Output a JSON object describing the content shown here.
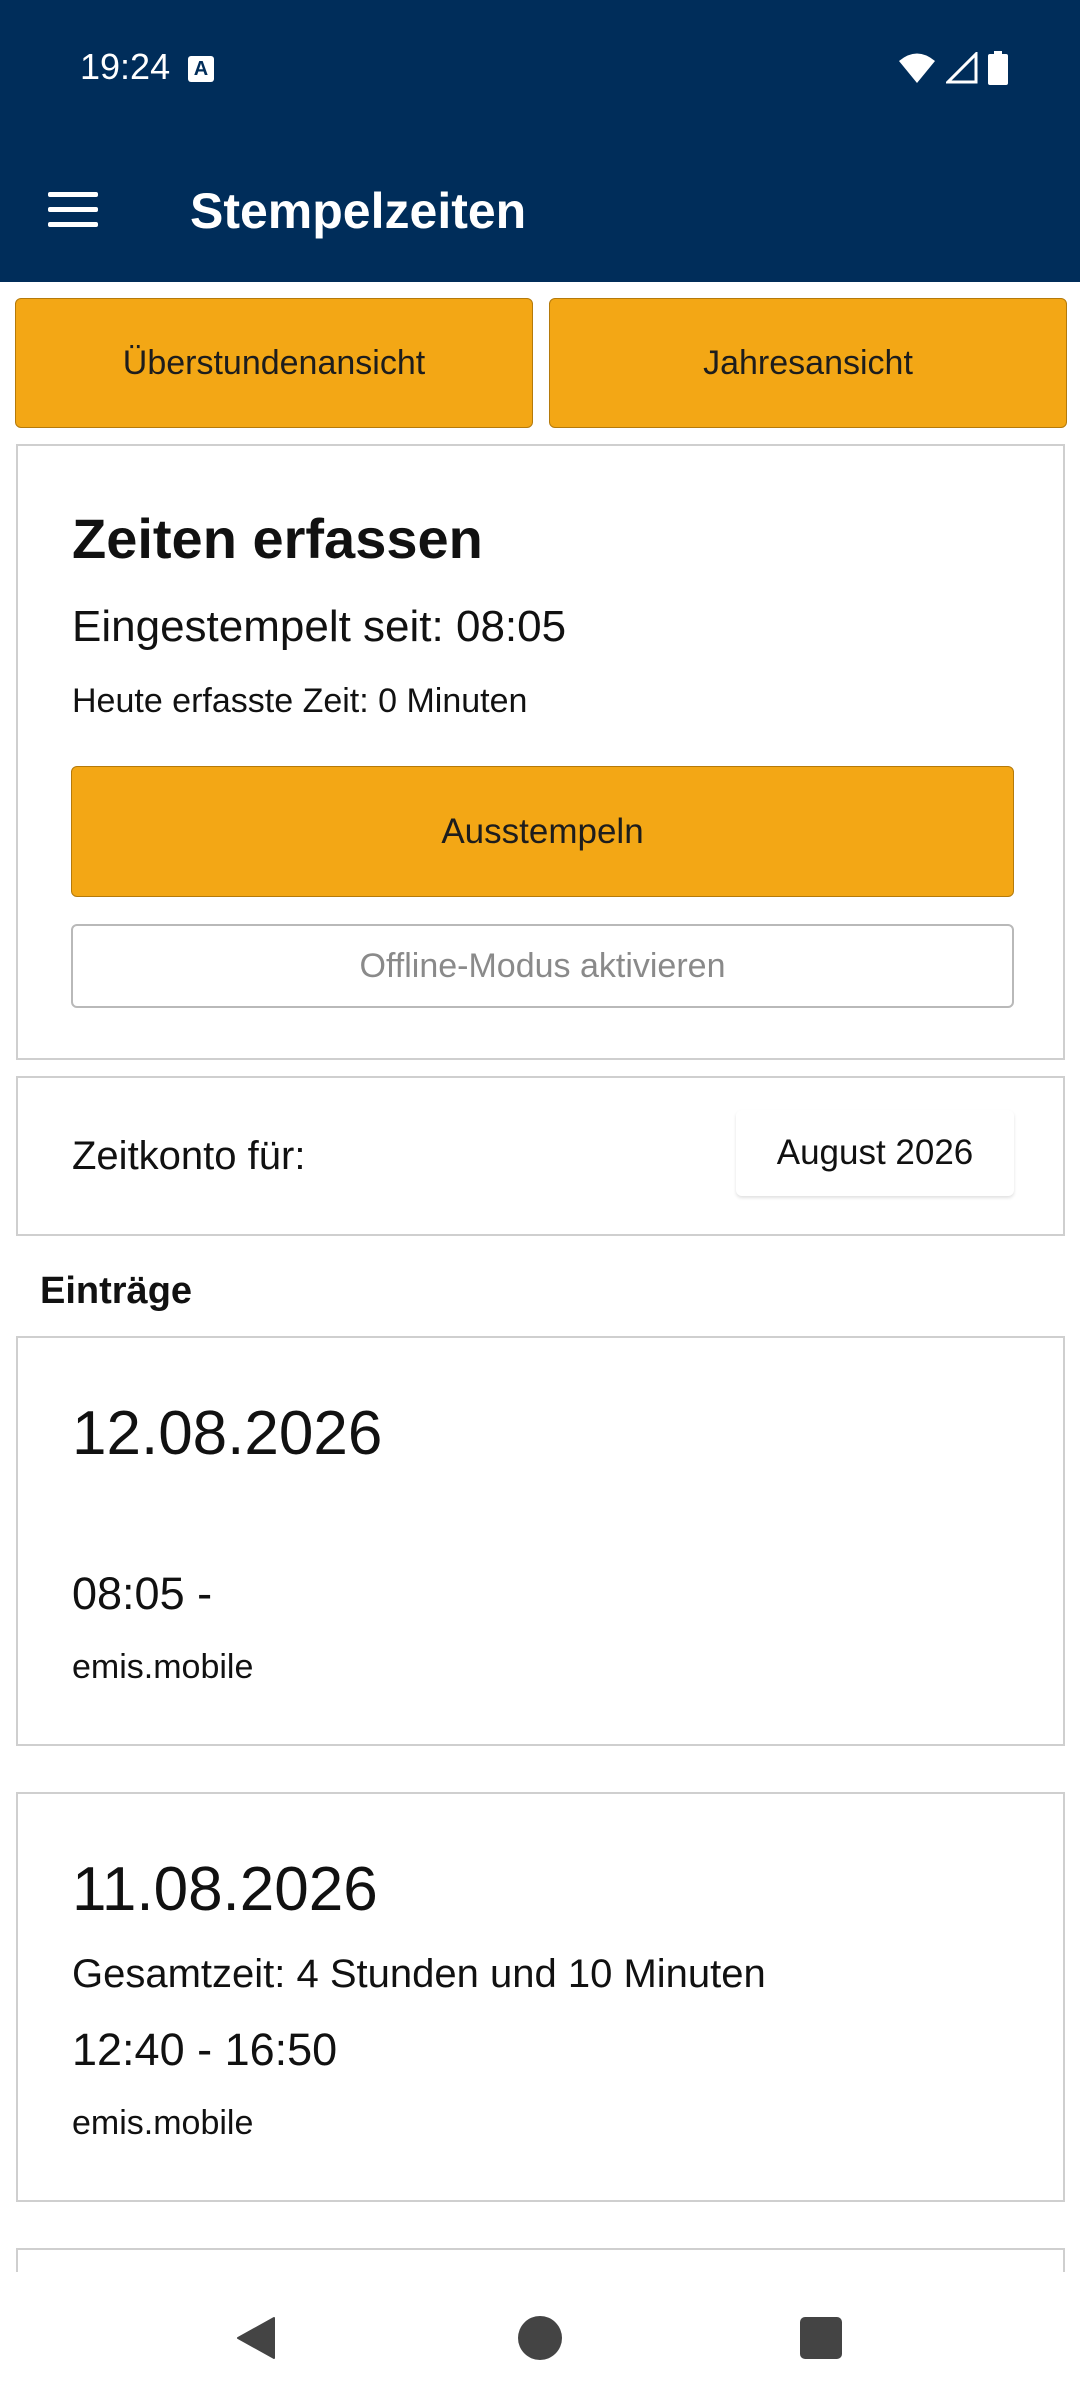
{
  "status_bar": {
    "time": "19:24",
    "indicator_letter": "A",
    "icons": [
      "wifi-icon",
      "signal-icon",
      "battery-icon"
    ]
  },
  "app_bar": {
    "title": "Stempelzeiten",
    "menu_icon": "hamburger-menu-icon"
  },
  "view_buttons": {
    "overtime_label": "Überstundenansicht",
    "year_label": "Jahresansicht"
  },
  "time_entry": {
    "title": "Zeiten erfassen",
    "clocked_in_since": "Eingestempelt seit: 08:05",
    "today_time": "Heute erfasste Zeit: 0 Minuten",
    "clock_out_label": "Ausstempeln",
    "offline_label": "Offline-Modus aktivieren"
  },
  "account": {
    "label": "Zeitkonto für:",
    "selected_month": "August 2026"
  },
  "entries_heading": "Einträge",
  "entries": [
    {
      "date": "12.08.2026",
      "total": "",
      "time_range": "08:05 -",
      "source": "emis.mobile"
    },
    {
      "date": "11.08.2026",
      "total": "Gesamtzeit: 4 Stunden und 10 Minuten",
      "time_range": "12:40 - 16:50",
      "source": "emis.mobile"
    }
  ],
  "nav_bar": {
    "icons": [
      "back-icon",
      "home-icon",
      "recents-icon"
    ]
  },
  "colors": {
    "app_bar": "#002d5a",
    "accent": "#f3a715",
    "card_border": "#cfcfcf"
  }
}
